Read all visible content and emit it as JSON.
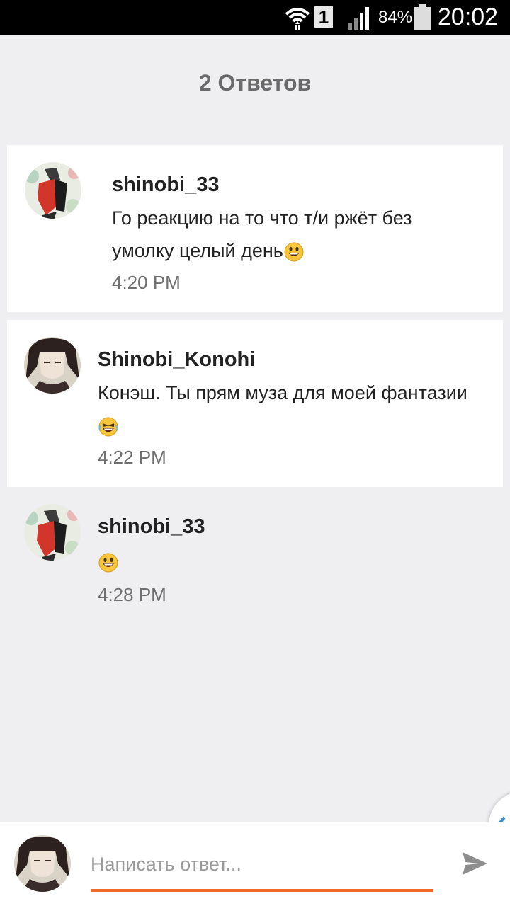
{
  "status_bar": {
    "sim_slot": "1",
    "battery_text": "84%",
    "time": "20:02",
    "icons": [
      "wifi-icon",
      "sim-icon",
      "signal-icon",
      "battery-icon"
    ]
  },
  "header": {
    "title": "2 Ответов"
  },
  "comments": [
    {
      "username": "shinobi_33",
      "text": "Го реакцию на то что т/и ржёт без умолку целый день",
      "emoji": "grinning-face-icon",
      "time": "4:20 PM"
    },
    {
      "username": "Shinobi_Konohi",
      "text": "Конэш. Ты прям муза для моей фантазии",
      "emoji": "laughing-face-icon",
      "time": "4:22 PM"
    },
    {
      "username": "shinobi_33",
      "text": "",
      "emoji": "grinning-face-icon",
      "time": "4:28 PM"
    }
  ],
  "reply": {
    "placeholder": "Написать ответ...",
    "accent": "#ee6a27",
    "send_icon": "send-icon"
  },
  "colors": {
    "background": "#efeef1",
    "card": "#ffffff",
    "accent": "#ee6a27"
  }
}
